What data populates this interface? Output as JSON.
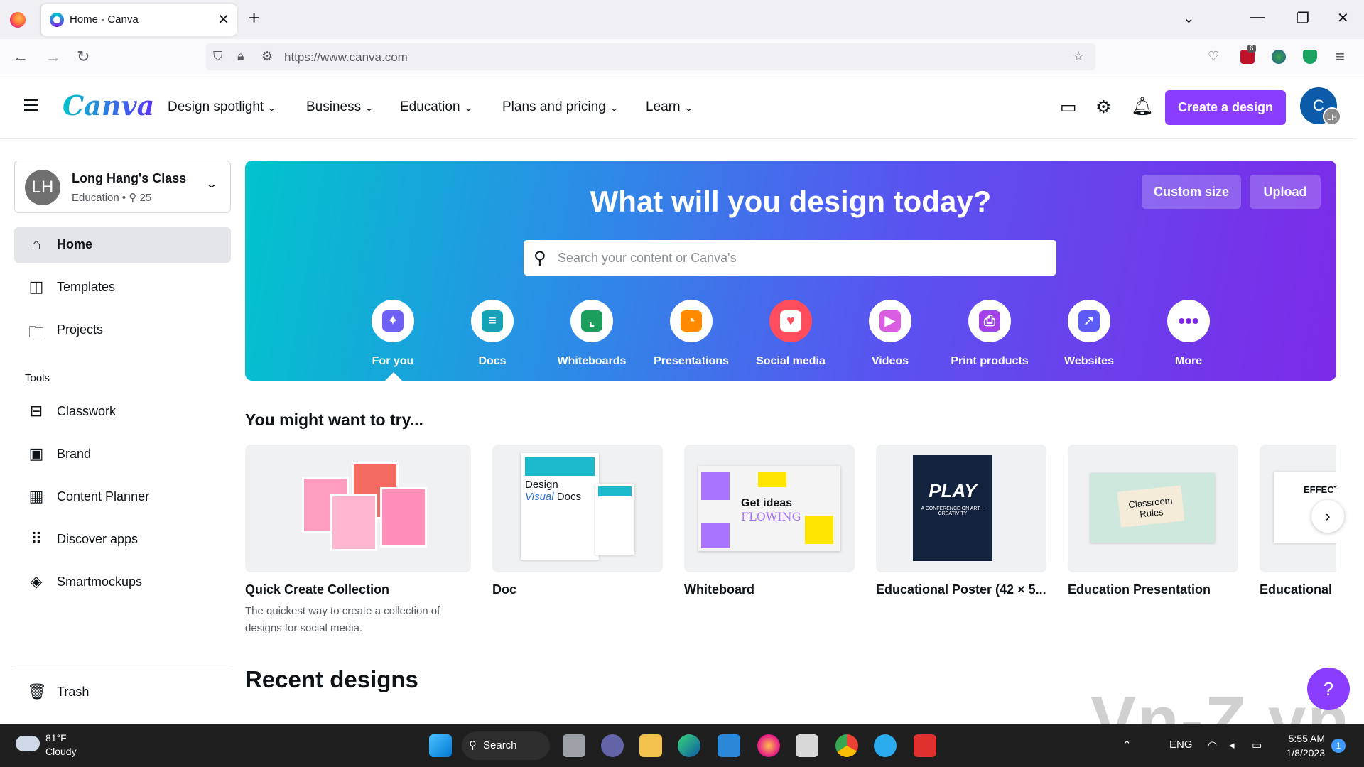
{
  "browser": {
    "tab_title": "Home - Canva",
    "url": "https://www.canva.com",
    "extension_badge": "6"
  },
  "header": {
    "logo": "Canva",
    "menu": [
      "Design spotlight",
      "Business",
      "Education",
      "Plans and pricing",
      "Learn"
    ],
    "create_label": "Create a design",
    "avatar_initial": "C",
    "avatar_badge": "LH"
  },
  "team": {
    "initials": "LH",
    "name": "Long Hang's Class",
    "plan": "Education",
    "members": "25"
  },
  "sidebar": {
    "nav": [
      {
        "label": "Home",
        "icon": "home-icon"
      },
      {
        "label": "Templates",
        "icon": "templates-icon"
      },
      {
        "label": "Projects",
        "icon": "folder-icon"
      }
    ],
    "tools_heading": "Tools",
    "tools": [
      {
        "label": "Classwork",
        "icon": "inbox-icon"
      },
      {
        "label": "Brand",
        "icon": "brand-icon"
      },
      {
        "label": "Content Planner",
        "icon": "calendar-icon"
      },
      {
        "label": "Discover apps",
        "icon": "apps-grid-icon"
      },
      {
        "label": "Smartmockups",
        "icon": "layers-icon"
      }
    ],
    "trash": "Trash"
  },
  "hero": {
    "title": "What will you design today?",
    "custom_size": "Custom size",
    "upload": "Upload",
    "search_placeholder": "Search your content or Canva's",
    "categories": [
      {
        "label": "For you",
        "color": "#6e5ff5"
      },
      {
        "label": "Docs",
        "color": "#13a3b5"
      },
      {
        "label": "Whiteboards",
        "color": "#1c9e5c"
      },
      {
        "label": "Presentations",
        "color": "#ff8a00"
      },
      {
        "label": "Social media",
        "color": "#ff4d5e"
      },
      {
        "label": "Videos",
        "color": "#d85de0"
      },
      {
        "label": "Print products",
        "color": "#a340e8"
      },
      {
        "label": "Websites",
        "color": "#5d5bf5"
      },
      {
        "label": "More",
        "color": "#7d2ae8"
      }
    ]
  },
  "suggestions": {
    "title": "You might want to try...",
    "cards": [
      {
        "title": "Quick Create Collection",
        "desc": "The quickest way to create a collection of designs for social media."
      },
      {
        "title": "Doc",
        "desc": ""
      },
      {
        "title": "Whiteboard",
        "desc": ""
      },
      {
        "title": "Educational Poster (42 × 5...",
        "desc": ""
      },
      {
        "title": "Education Presentation",
        "desc": ""
      },
      {
        "title": "Educational",
        "desc": ""
      }
    ]
  },
  "thumbs": {
    "doc_line1": "Design",
    "doc_line2": "Visual",
    "doc_line3": "Docs",
    "wb_line1": "Get ideas",
    "wb_line2": "FLOWING",
    "poster_title": "PLAY",
    "poster_sub": "A CONFERENCE ON ART + CREATIVITY",
    "pres_title": "Classroom Rules",
    "edu_title": "EFFECTIV"
  },
  "recent": {
    "title": "Recent designs"
  },
  "help": "?",
  "watermark": "Vn-Z.vn",
  "taskbar": {
    "temp": "81°F",
    "weather": "Cloudy",
    "search": "Search",
    "lang": "ENG",
    "time": "5:55 AM",
    "date": "1/8/2023",
    "notifications": "1"
  }
}
